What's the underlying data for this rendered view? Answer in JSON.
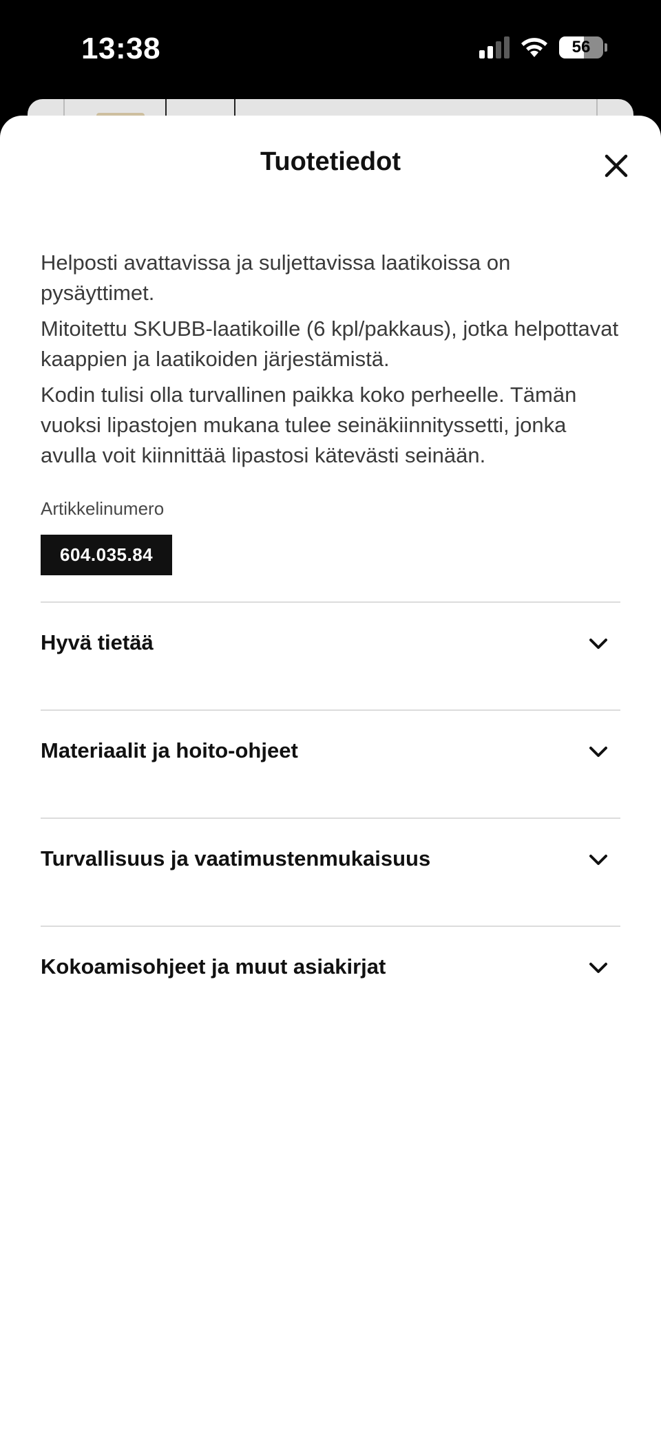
{
  "status_bar": {
    "time": "13:38",
    "battery": "56",
    "battery_level": 0.56,
    "icons": [
      "cellular-signal-icon",
      "wifi-icon",
      "battery-icon"
    ]
  },
  "sheet": {
    "title": "Tuotetiedot",
    "close_icon": "close-icon",
    "paragraphs": [
      "Helposti avattavissa ja suljettavissa laatikoissa on pysäyttimet.",
      "Mitoitettu SKUBB-laatikoille (6 kpl/pakkaus), jotka helpottavat kaappien ja laatikoiden järjestämistä.",
      "Kodin tulisi olla turvallinen paikka koko perheelle. Tämän vuoksi lipastojen mukana tulee seinäkiinnityssetti, jonka avulla voit kiinnittää lipastosi kätevästi seinään."
    ],
    "article_label": "Artikkelinumero",
    "article_number": "604.035.84",
    "accordion": [
      {
        "label": "Hyvä tietää",
        "icon": "chevron-down-icon"
      },
      {
        "label": "Materiaalit ja hoito-ohjeet",
        "icon": "chevron-down-icon"
      },
      {
        "label": "Turvallisuus ja vaatimustenmukaisuus",
        "icon": "chevron-down-icon"
      },
      {
        "label": "Kokoamisohjeet ja muut asiakirjat",
        "icon": "chevron-down-icon"
      }
    ]
  },
  "colors": {
    "text_primary": "#111111",
    "text_body": "#3a3a3a",
    "badge_bg": "#111111",
    "divider": "#dcdcdc"
  }
}
